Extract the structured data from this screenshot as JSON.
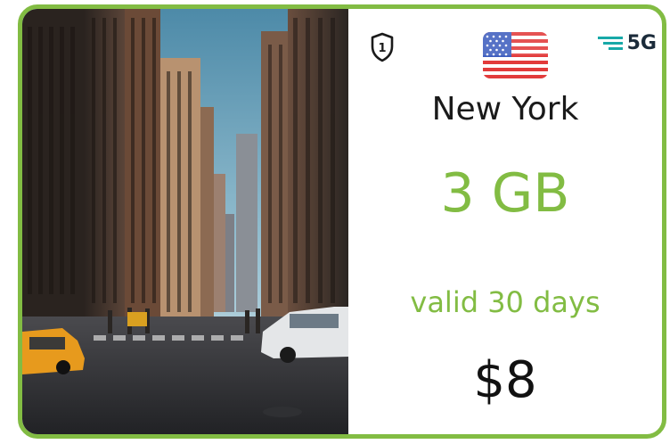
{
  "card": {
    "city": "New York",
    "data_amount": "3 GB",
    "validity": "valid 30 days",
    "price": "$8",
    "network": "5G",
    "badge_number": "1",
    "flag_icon": "us-flag-icon",
    "photo": "new-york-street-photo"
  },
  "colors": {
    "accent": "#82bc43",
    "text_dark": "#1a1a1a",
    "network_bars": "#17a9a8"
  }
}
